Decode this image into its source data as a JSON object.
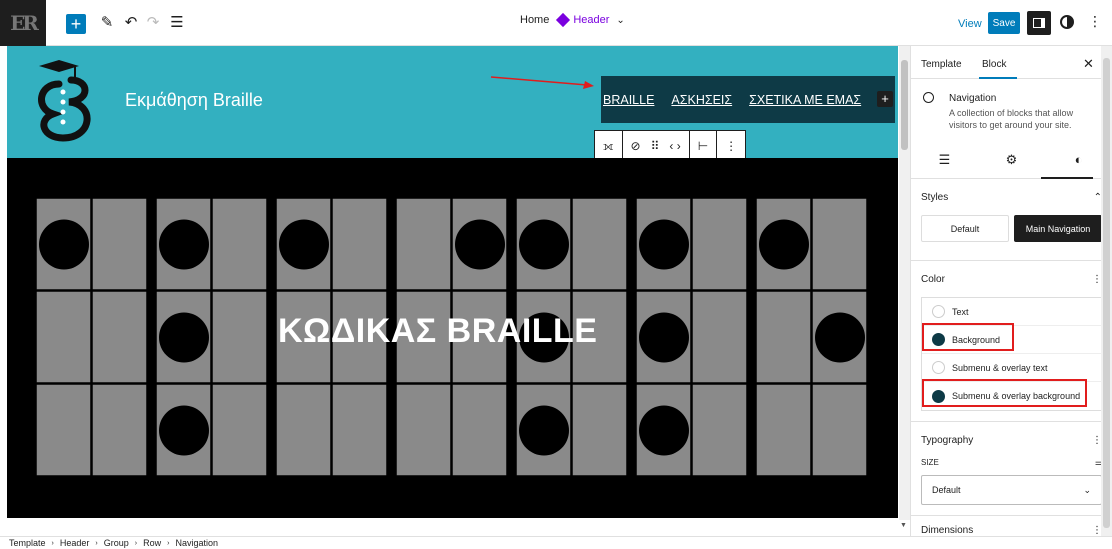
{
  "topbar": {
    "site_logo_text": "ER",
    "inserter_label": "+",
    "doc_home": "Home",
    "doc_template": "Header",
    "view_label": "View",
    "save_label": "Save"
  },
  "header": {
    "site_title": "Εκμάθηση Braille",
    "nav_items": [
      "BRAILLE",
      "ΑΣΚΗΣΕΙΣ",
      "ΣΧΕΤΙΚΑ ΜΕ ΕΜΑΣ"
    ],
    "nav_add": "+"
  },
  "hero": {
    "title": "ΚΩΔΙΚΑΣ BRAILLE",
    "dot_cells": [
      [
        1,
        0,
        0,
        0,
        0,
        0
      ],
      [
        1,
        0,
        1,
        0,
        1,
        0
      ],
      [
        1,
        0,
        0,
        0,
        0,
        0
      ],
      [
        0,
        1,
        0,
        0,
        0,
        0
      ],
      [
        1,
        0,
        1,
        0,
        1,
        0
      ],
      [
        1,
        0,
        1,
        0,
        1,
        0
      ],
      [
        1,
        0,
        0,
        1,
        0,
        0
      ]
    ]
  },
  "footer": {
    "breadcrumb": [
      "Template",
      "Header",
      "Group",
      "Row",
      "Navigation"
    ]
  },
  "sidebar": {
    "tabs": [
      "Template",
      "Block"
    ],
    "active_tab": "Block",
    "block": {
      "title": "Navigation",
      "description": "A collection of blocks that allow visitors to get around your site."
    },
    "styles": {
      "title": "Styles",
      "options": [
        "Default",
        "Main Navigation"
      ],
      "selected": "Main Navigation"
    },
    "color": {
      "title": "Color",
      "items": [
        {
          "label": "Text",
          "swatch": "#ffffff"
        },
        {
          "label": "Background",
          "swatch": "#0e3a46"
        },
        {
          "label": "Submenu & overlay text",
          "swatch": "#ffffff"
        },
        {
          "label": "Submenu & overlay background",
          "swatch": "#0e3a46"
        }
      ]
    },
    "typography": {
      "title": "Typography",
      "size_label": "SIZE",
      "size_value": "Default"
    },
    "dimensions_title": "Dimensions"
  },
  "colors": {
    "header_bg": "#33b0c0",
    "nav_bg": "#0e3a46",
    "accent": "#007cba",
    "annotation": "#e11d1d"
  }
}
